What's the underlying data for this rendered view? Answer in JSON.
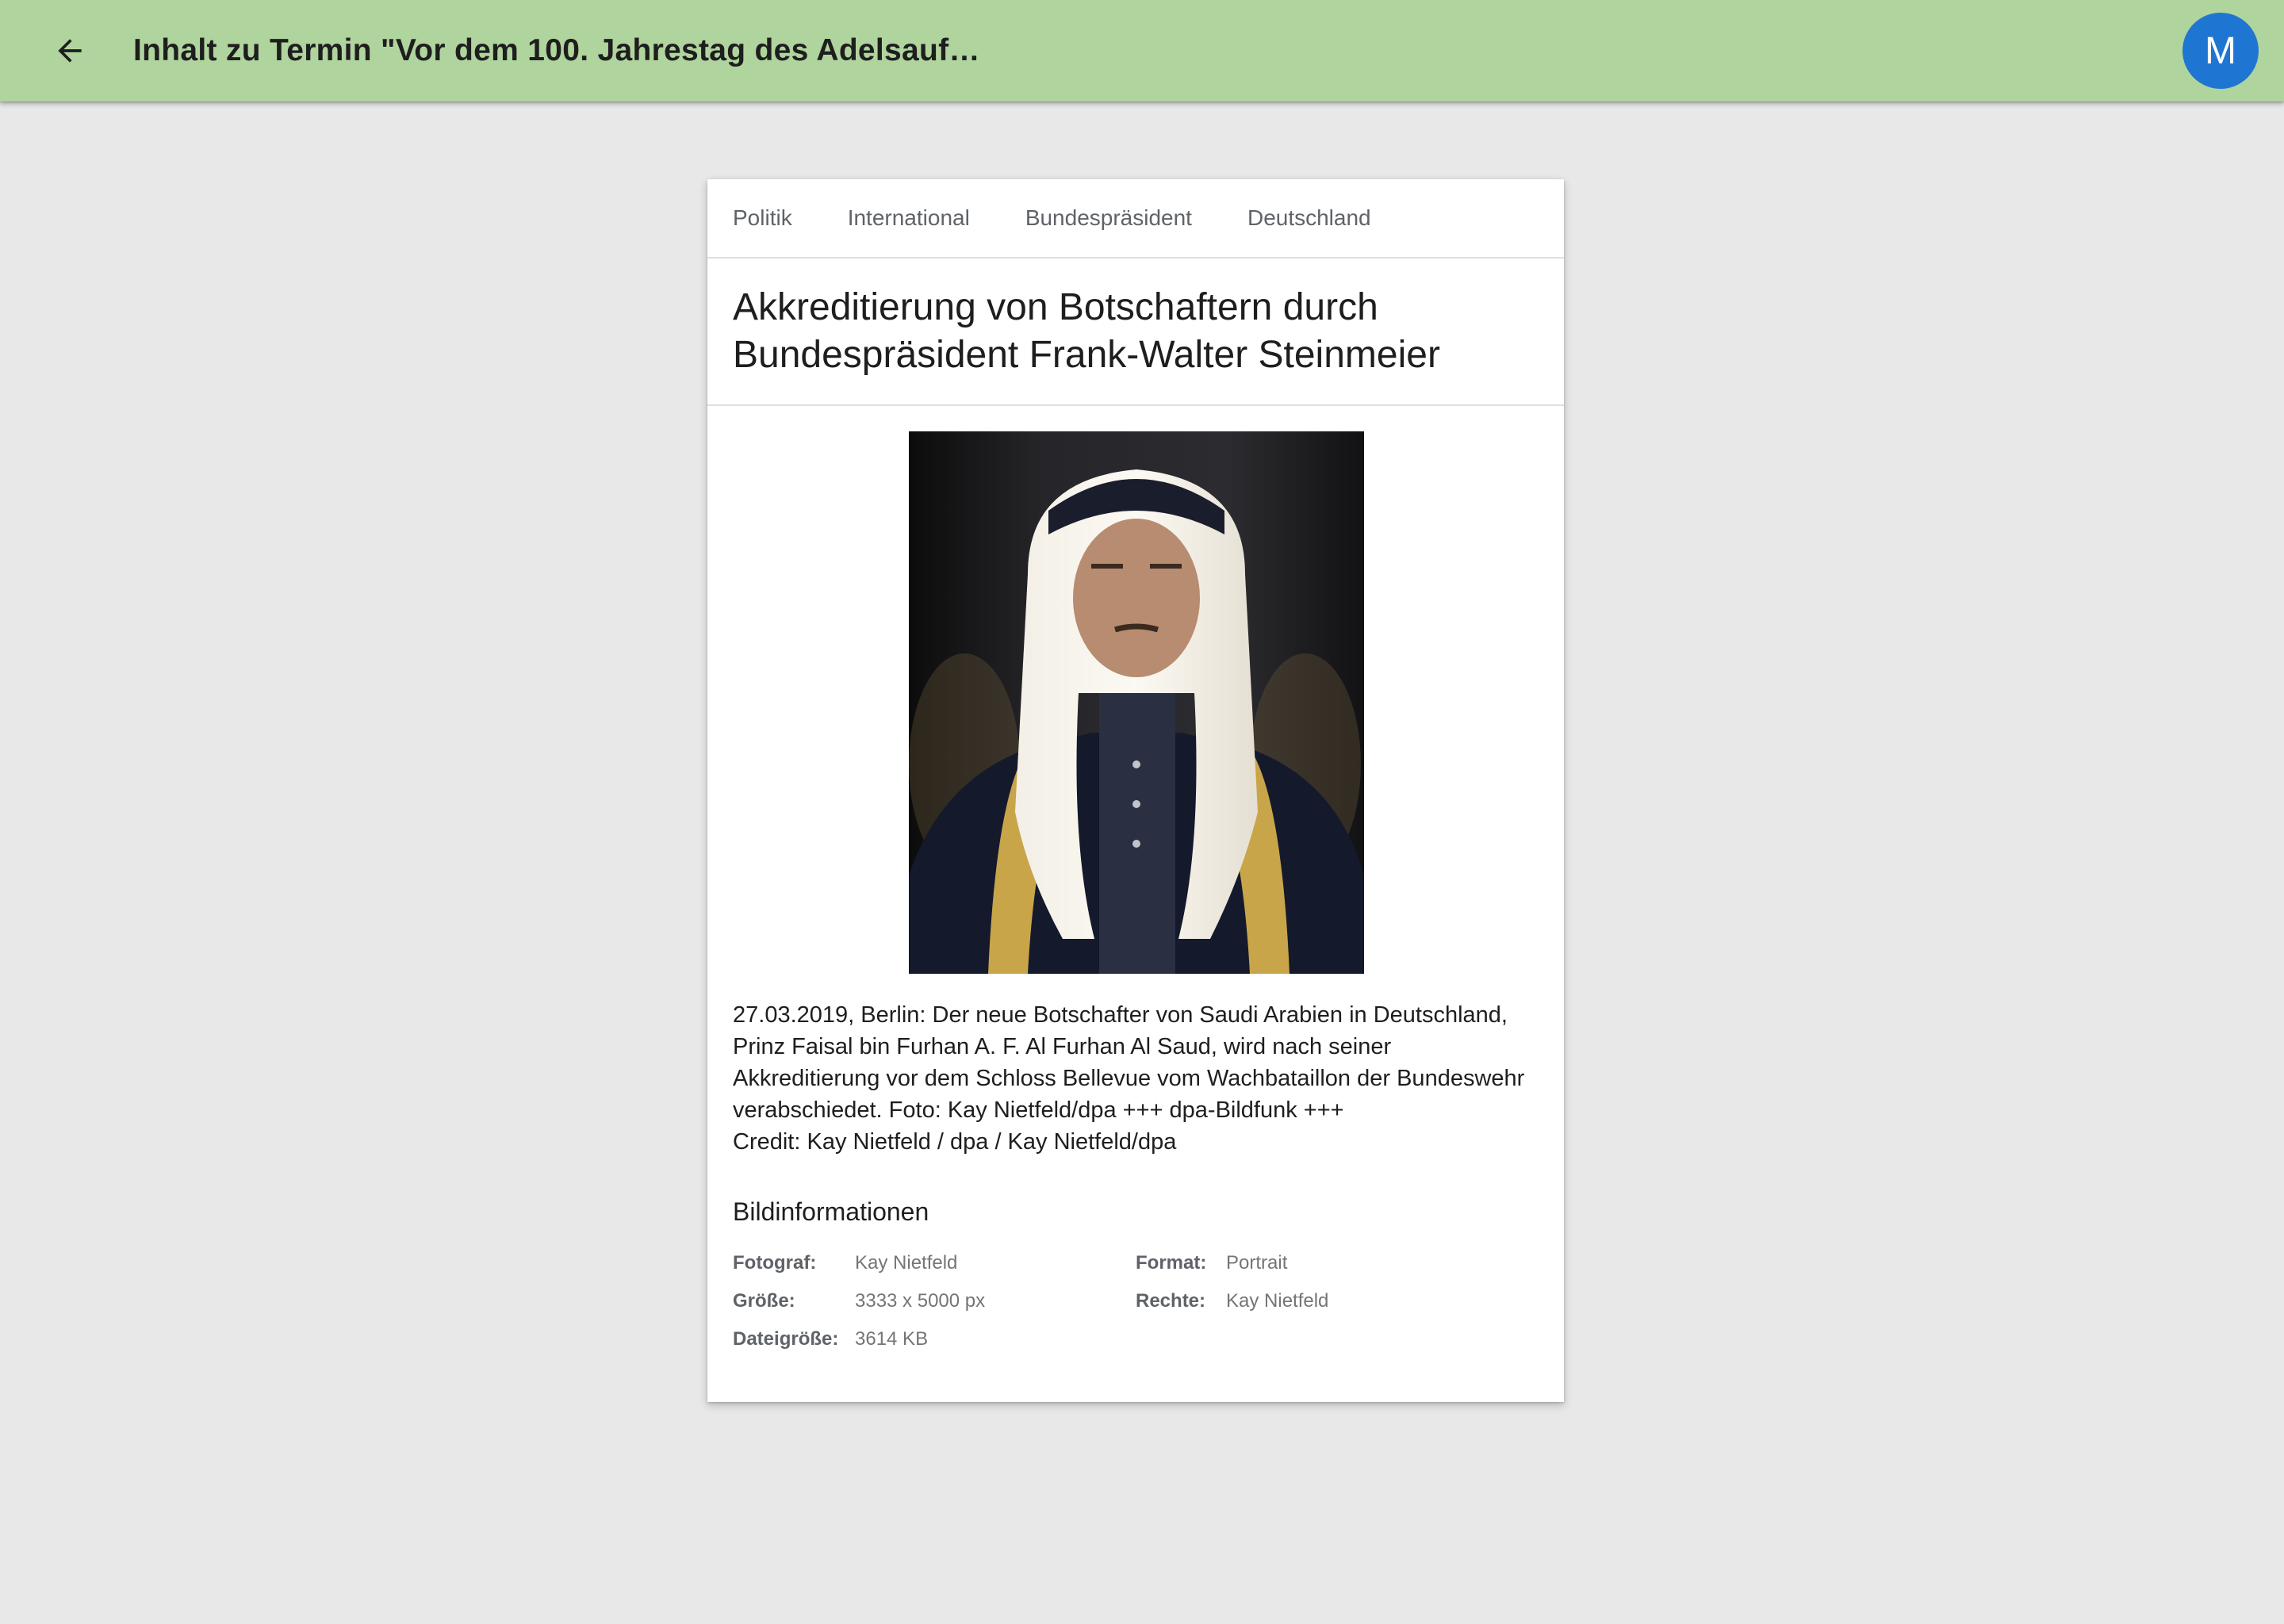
{
  "appbar": {
    "title": "Inhalt zu Termin \"Vor dem 100. Jahrestag des Adelsauf…",
    "avatar_initial": "M",
    "background": "#b0d49d",
    "icons": {
      "back": "arrow-left-icon"
    }
  },
  "article": {
    "tags": [
      "Politik",
      "International",
      "Bundespräsident",
      "Deutschland"
    ],
    "headline": "Akkreditierung von Botschaftern durch Bundespräsident Frank-Walter Steinmeier",
    "caption": "27.03.2019, Berlin: Der neue Botschafter von Saudi Arabien in Deutschland, Prinz Faisal bin Furhan A. F. Al Furhan Al Saud, wird nach seiner Akkreditierung vor dem Schloss Bellevue vom Wachbataillon der Bundeswehr verabschiedet. Foto: Kay Nietfeld/dpa +++ dpa-Bildfunk +++",
    "credit": "Credit: Kay Nietfeld / dpa / Kay Nietfeld/dpa"
  },
  "info": {
    "title": "Bildinformationen",
    "fotograf_label": "Fotograf:",
    "fotograf_value": "Kay Nietfeld",
    "groesse_label": "Größe:",
    "groesse_value": "3333 x 5000 px",
    "dateigroesse_label": "Dateigröße:",
    "dateigroesse_value": "3614 KB",
    "format_label": "Format:",
    "format_value": "Portrait",
    "rechte_label": "Rechte:",
    "rechte_value": "Kay Nietfeld"
  },
  "colors": {
    "appbar": "#b0d49d",
    "avatar": "#1f76d2",
    "page_background": "#e8e8e8"
  }
}
